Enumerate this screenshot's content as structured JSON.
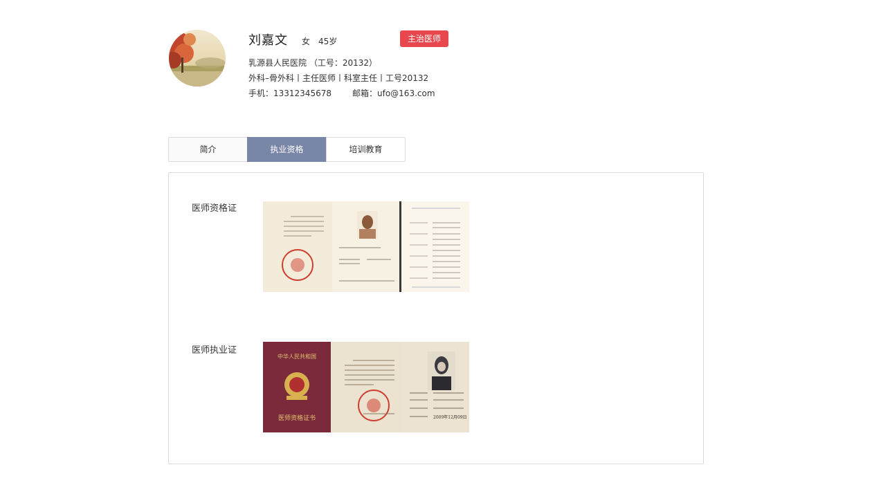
{
  "profile": {
    "name": "刘嘉文",
    "gender": "女",
    "age": "45岁",
    "badge": "主治医师",
    "hospital_line": "乳源县人民医院 （工号：20132）",
    "dept_line": "外科–骨外科丨主任医师丨科室主任丨工号20132",
    "phone_line": "手机：13312345678",
    "email_line": "邮箱：ufo@163.com"
  },
  "tabs": [
    {
      "label": "简介"
    },
    {
      "label": "执业资格"
    },
    {
      "label": "培训教育"
    }
  ],
  "active_tab": "执业资格",
  "certificates": [
    {
      "label": "医师资格证"
    },
    {
      "label": "医师执业证",
      "cover_title": "中华人民共和国",
      "cover_subtitle": "医师资格证书",
      "issue_date": "2009年12月09日"
    }
  ],
  "colors": {
    "badge": "#e8474e",
    "active_tab": "#7a86a8",
    "border": "#d9d9d9"
  }
}
